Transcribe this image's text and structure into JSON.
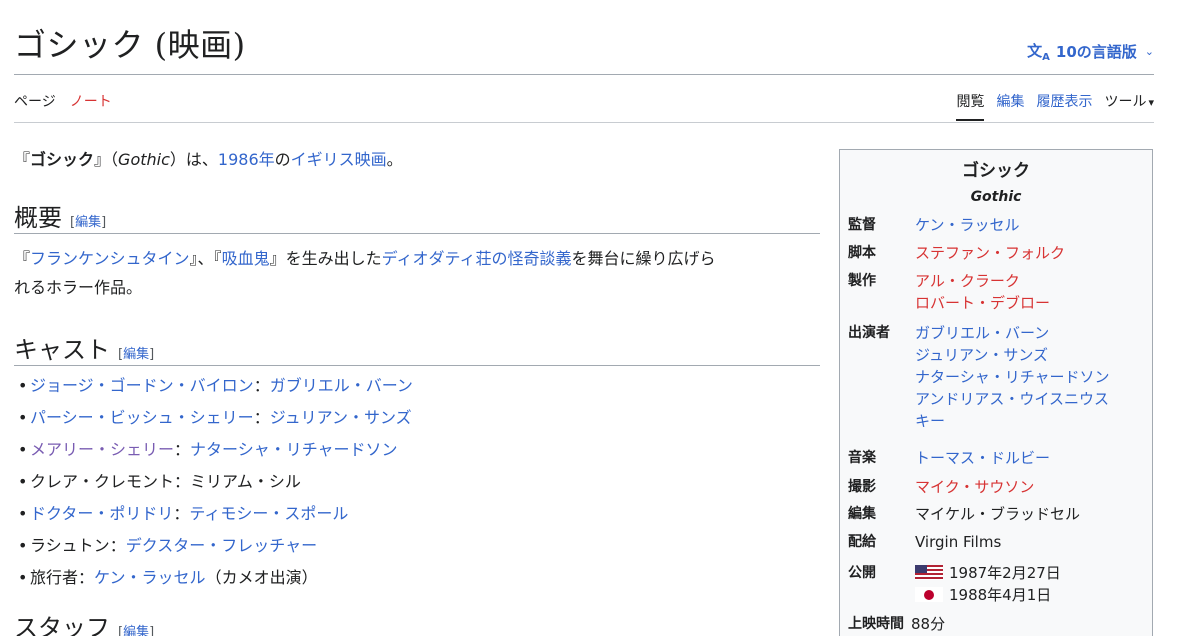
{
  "page": {
    "title": "ゴシック (映画)",
    "languages_label": "10の言語版",
    "languages_icon": "translate-icon"
  },
  "tabs": {
    "left": [
      "ページ",
      "ノート"
    ],
    "right": [
      "閲覧",
      "編集",
      "履歴表示"
    ],
    "tools_label": "ツール"
  },
  "lead": {
    "open": "『",
    "title_bold": "ゴシック",
    "close": "』（",
    "original_title": "Gothic",
    "mid": "）は、",
    "year_link": "1986年",
    "of": "の",
    "country_link": "イギリス映画",
    "end": "。"
  },
  "sections": {
    "edit_label": "編集",
    "overview": {
      "heading": "概要",
      "p_open1": "『",
      "link1": "フランケンシュタイン",
      "p_sep": "』、『",
      "link2": "吸血鬼",
      "p_mid": "』を生み出した",
      "link3": "ディオダティ荘の怪奇談義",
      "p_end1": "を舞台に繰り広げら",
      "p_line2": "れるホラー作品。"
    },
    "cast": {
      "heading": "キャスト",
      "items": [
        {
          "role": "ジョージ・ゴードン・バイロン",
          "sep": "：",
          "actor": "ガブリエル・バーン"
        },
        {
          "role": "パーシー・ビッシュ・シェリー",
          "sep": "：",
          "actor": "ジュリアン・サンズ"
        },
        {
          "role": "メアリー・シェリー",
          "sep": "：",
          "actor": "ナターシャ・リチャードソン"
        },
        {
          "role": "クレア・クレモント",
          "sep": "：",
          "actor": "ミリアム・シル"
        },
        {
          "role": "ドクター・ポリドリ",
          "sep": "：",
          "actor": "ティモシー・スポール"
        },
        {
          "role": "ラシュトン",
          "sep": "：",
          "actor": "デクスター・フレッチャー"
        },
        {
          "role": "旅行者",
          "sep": "：",
          "actor": "ケン・ラッセル",
          "note": "（カメオ出演）"
        }
      ]
    },
    "staff": {
      "heading": "スタッフ"
    }
  },
  "infobox": {
    "title": "ゴシック",
    "subtitle": "Gothic",
    "rows": {
      "director": {
        "label": "監督",
        "values": [
          "ケン・ラッセル"
        ]
      },
      "writer": {
        "label": "脚本",
        "values": [
          "ステファン・フォルク"
        ]
      },
      "producer": {
        "label": "製作",
        "values": [
          "アル・クラーク",
          "ロバート・デブロー"
        ]
      },
      "starring": {
        "label": "出演者",
        "values": [
          "ガブリエル・バーン",
          "ジュリアン・サンズ",
          "ナターシャ・リチャードソン",
          "アンドリアス・ウイスニウス",
          "キー"
        ]
      },
      "music": {
        "label": "音楽",
        "values": [
          "トーマス・ドルビー"
        ]
      },
      "cinematography": {
        "label": "撮影",
        "values": [
          "マイク・サウソン"
        ]
      },
      "editing": {
        "label": "編集",
        "values": [
          "マイケル・ブラッドセル"
        ]
      },
      "distributor": {
        "label": "配給",
        "values": [
          "Virgin Films"
        ]
      },
      "release": {
        "label": "公開",
        "values": [
          "1987年2月27日",
          "1988年4月1日"
        ]
      },
      "runtime": {
        "label": "上映時間",
        "values": [
          "88分"
        ]
      }
    }
  },
  "colors": {
    "link": "#3366cc",
    "redlink": "#d73333",
    "visited": "#795cb2",
    "text": "#202122"
  }
}
